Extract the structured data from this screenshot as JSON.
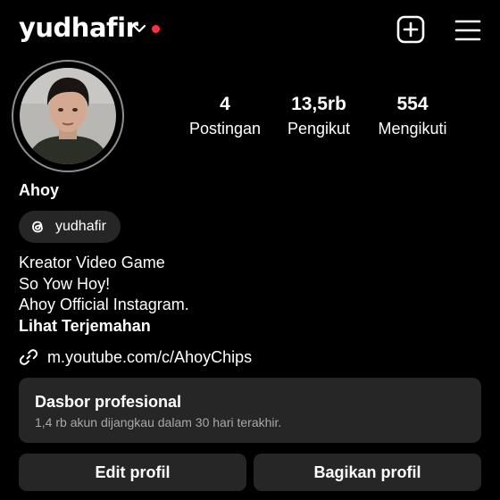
{
  "header": {
    "username": "yudhafir",
    "notification_dot_color": "#ff3040",
    "icons": [
      "chevron-down-icon",
      "plus-square-icon",
      "hamburger-menu-icon"
    ]
  },
  "profile": {
    "avatar": "profile-photo",
    "display_name": "Ahoy",
    "stats": {
      "posts": {
        "value": "4",
        "label": "Postingan"
      },
      "followers": {
        "value": "13,5rb",
        "label": "Pengikut"
      },
      "following": {
        "value": "554",
        "label": "Mengikuti"
      }
    },
    "threads_handle": "yudhafir",
    "bio": {
      "lines": [
        "Kreator Video Game",
        "So Yow Hoy!",
        "Ahoy Official Instagram."
      ],
      "translate": "Lihat Terjemahan"
    },
    "link": "m.youtube.com/c/AhoyChips"
  },
  "dashboard": {
    "title": "Dasbor profesional",
    "subtitle": "1,4 rb akun dijangkau dalam 30 hari terakhir."
  },
  "actions": {
    "edit_label": "Edit profil",
    "share_label": "Bagikan profil"
  }
}
